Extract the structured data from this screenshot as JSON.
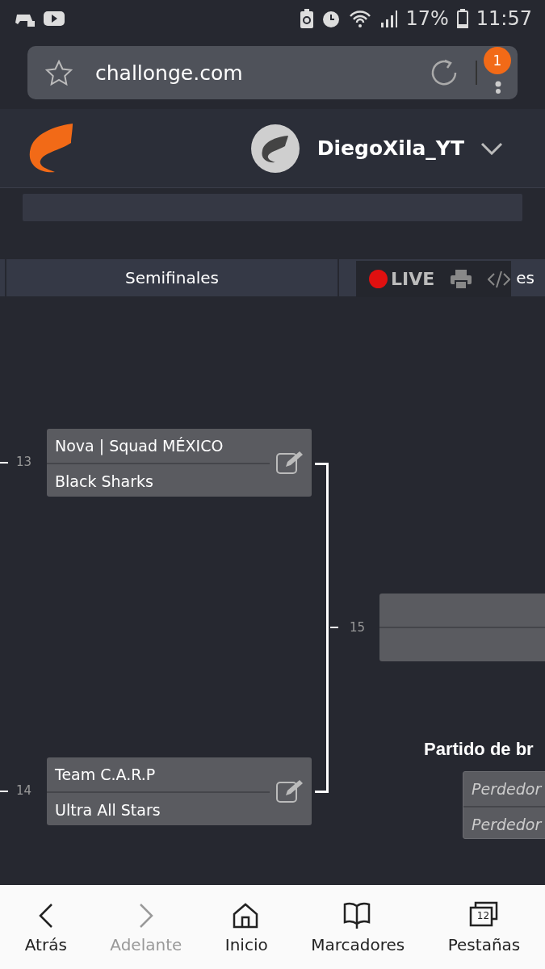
{
  "status_bar": {
    "battery": "17%",
    "time": "11:57"
  },
  "browser": {
    "url": "challonge.com",
    "menu_badge": "1"
  },
  "header": {
    "username": "DiegoXila_YT"
  },
  "rounds": [
    {
      "label": "Semifinales"
    },
    {
      "label": "es"
    }
  ],
  "toolbar": {
    "live": "LIVE"
  },
  "matches": [
    {
      "number": "13",
      "players": [
        "Nova | Squad MÉXICO",
        "Black Sharks"
      ]
    },
    {
      "number": "14",
      "players": [
        "Team C.A.R.P",
        "Ultra All Stars"
      ]
    }
  ],
  "final": {
    "number": "15"
  },
  "third_place": {
    "title": "Partido de br",
    "players": [
      "Perdedor",
      "Perdedor"
    ]
  },
  "nav": [
    {
      "label": "Atrás",
      "kind": "back",
      "disabled": false
    },
    {
      "label": "Adelante",
      "kind": "forward",
      "disabled": true
    },
    {
      "label": "Inicio",
      "kind": "home",
      "disabled": false
    },
    {
      "label": "Marcadores",
      "kind": "bookmarks",
      "disabled": false
    },
    {
      "label": "Pestañas",
      "kind": "tabs",
      "disabled": false,
      "count": "12"
    }
  ]
}
